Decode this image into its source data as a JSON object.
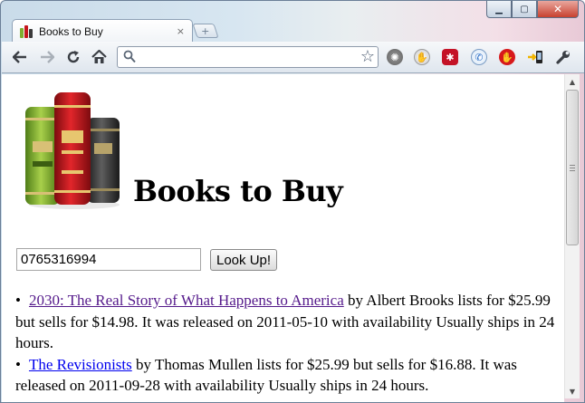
{
  "browser": {
    "tab_title": "Books to Buy",
    "tab_close_glyph": "×",
    "new_tab_glyph": "+",
    "window_controls": {
      "minimize": "▁",
      "maximize": "▢",
      "close": "✕"
    },
    "omnibox_value": "",
    "icons": [
      "back-icon",
      "forward-icon",
      "reload-icon",
      "home-icon",
      "search-icon",
      "bookmark-star-icon",
      "gear-extension-icon",
      "hand-extension-icon",
      "lastpass-extension-icon",
      "phone-extension-icon",
      "stop-extension-icon",
      "device-extension-icon",
      "wrench-icon"
    ]
  },
  "page": {
    "heading": "Books to Buy",
    "isbn_value": "0765316994",
    "lookup_label": "Look Up!",
    "results": [
      {
        "title": "2030: The Real Story of What Happens to America",
        "details": " by Albert Brooks lists for $25.99 but sells for $14.98. It was released on 2011-05-10 with availability Usually ships in 24 hours."
      },
      {
        "title": "The Revisionists",
        "details": " by Thomas Mullen lists for $25.99 but sells for $16.88. It was released on 2011-09-28 with availability Usually ships in 24 hours."
      }
    ]
  },
  "colors": {
    "visited_link": "#551a8b",
    "link": "#0000ee",
    "book_green": "#7fae2f",
    "book_red": "#c4161c",
    "book_dark": "#3a3a3a"
  }
}
